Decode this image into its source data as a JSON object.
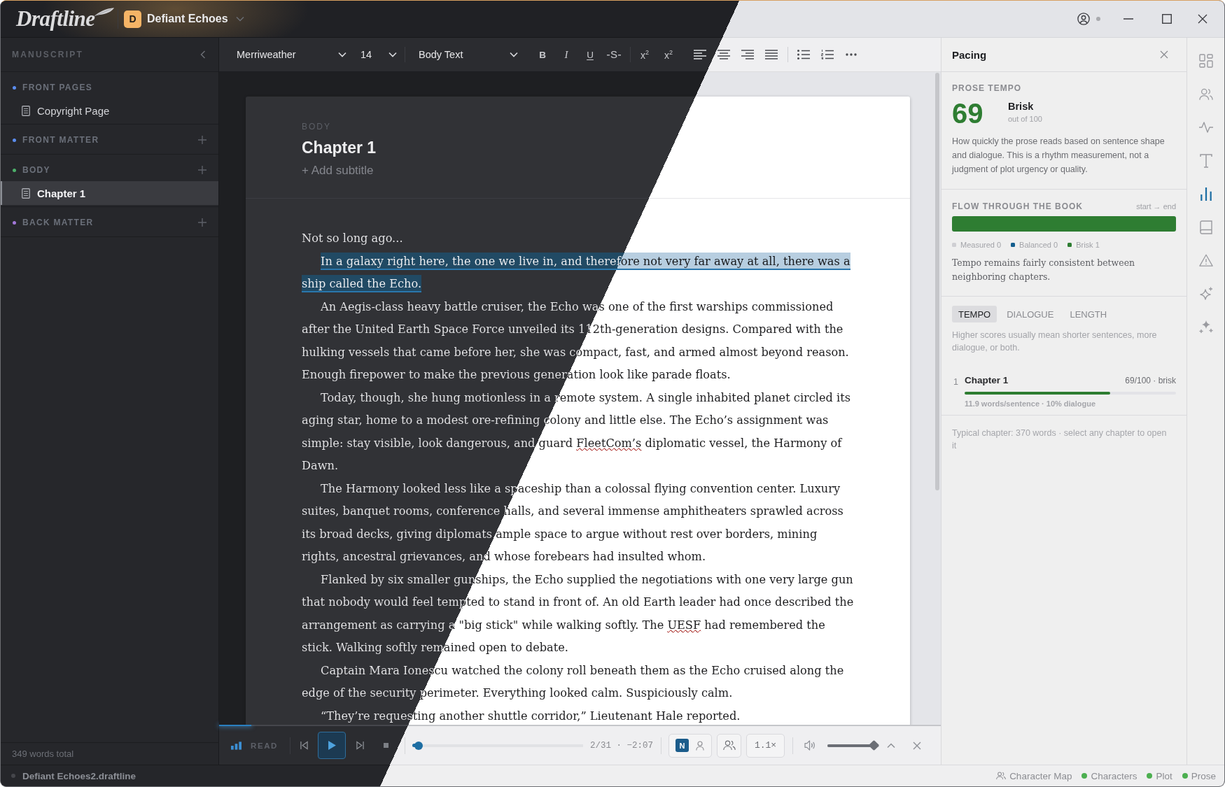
{
  "window": {
    "logo": "Draftline",
    "project": {
      "initial": "D",
      "name": "Defiant Echoes"
    },
    "account": {
      "online": false
    }
  },
  "sidebar": {
    "title": "MANUSCRIPT",
    "sections": [
      {
        "label": "FRONT PAGES",
        "color": "#5b8def",
        "addable": false,
        "items": [
          {
            "label": "Copyright Page",
            "selected": false
          }
        ]
      },
      {
        "label": "FRONT MATTER",
        "color": "#5b8def",
        "addable": true
      },
      {
        "label": "BODY",
        "color": "#4caf6a",
        "addable": true,
        "items": [
          {
            "label": "Chapter 1",
            "selected": true
          }
        ]
      },
      {
        "label": "BACK MATTER",
        "color": "#a277d9",
        "addable": true
      }
    ],
    "footer": "349 words total"
  },
  "toolbar": {
    "font": "Merriweather",
    "size": "14",
    "style": "Body Text",
    "format_buttons": [
      {
        "label": "B",
        "kind": "bold"
      },
      {
        "label": "I",
        "kind": "italic"
      },
      {
        "label": "U",
        "kind": "underline"
      },
      {
        "label": "S",
        "kind": "strike"
      },
      {
        "label": "x$^{2}$",
        "kind": "superscript"
      },
      {
        "label": "x$^{2}$",
        "kind": "superscript"
      }
    ]
  },
  "document": {
    "section": "BODY",
    "title": "Chapter 1",
    "add_subtitle": "+ Add subtitle",
    "paragraphs": [
      {
        "indent": false,
        "highlighted": false,
        "text": "Not so long ago..."
      },
      {
        "indent": true,
        "highlighted": true,
        "text": "In a galaxy right here, the one we live in, and therefore not very far away at all, there was a ship called the Echo."
      },
      {
        "indent": true,
        "highlighted": false,
        "text": "An Aegis-class heavy battle cruiser, the Echo was one of the first warships commissioned after the United Earth Space Force unveiled its 112th-generation designs. Compared with the hulking vessels that came before her, she was compact, fast, and armed almost beyond reason. Enough firepower to make the previous generation look like parade floats."
      },
      {
        "indent": true,
        "highlighted": false,
        "parts": [
          {
            "text": "Today, though, she hung motionless in a remote system. A single inhabited planet circled its aging star, home to a modest ore-refining colony and little else. The Echo’s assignment was simple: stay visible, look dangerous, and guard ",
            "misspelled": false
          },
          {
            "text": "FleetCom’s",
            "misspelled": true
          },
          {
            "text": " diplomatic vessel, the Harmony of Dawn.",
            "misspelled": false
          }
        ]
      },
      {
        "indent": true,
        "highlighted": false,
        "text": "The Harmony looked less like a spaceship than a colossal flying convention center. Luxury suites, banquet rooms, conference halls, and several immense amphitheaters sprawled across its broad decks, giving diplomats ample space to argue without rest over borders, mining rights, ancestral grievances, and whose forebears had insulted whom."
      },
      {
        "indent": true,
        "highlighted": false,
        "parts": [
          {
            "text": "Flanked by six smaller gunships, the Echo supplied the negotiations with one very large gun that nobody would feel tempted to stand in front of. An old Earth leader had once described the arrangement as carrying a \"big stick\" while walking softly. The ",
            "misspelled": false
          },
          {
            "text": "UESF",
            "misspelled": true
          },
          {
            "text": " had remembered the stick. Walking softly remained open to debate.",
            "misspelled": false
          }
        ]
      },
      {
        "indent": true,
        "highlighted": false,
        "text": "Captain Mara Ionescu watched the colony roll beneath them as the Echo cruised along the edge of the security perimeter. Everything looked calm. Suspiciously calm."
      },
      {
        "indent": true,
        "highlighted": false,
        "text": "“They’re requesting another shuttle corridor,” Lieutenant Hale reported."
      }
    ]
  },
  "player": {
    "progress": {
      "level": 0.045
    },
    "mode": "READ",
    "position": {
      "level": 0.035
    },
    "time": "2/31 · −2:07",
    "narrator": {
      "label": "N",
      "selected": true
    },
    "speed": "1.1×",
    "volume": {
      "level": 0.92
    }
  },
  "pacing": {
    "title": "Pacing",
    "tempo": {
      "heading": "PROSE TEMPO",
      "score": "69",
      "label": "Brisk",
      "scale": "out of 100",
      "description": "How quickly the prose reads based on sentence shape and dialogue. This is a rhythm measurement, not a judgment of plot urgency or quality."
    },
    "flow": {
      "heading": "FLOW THROUGH THE BOOK",
      "direction": "start → end",
      "segments": [
        {
          "color": "#2e7d32"
        }
      ],
      "legend": [
        {
          "label": "Measured 0",
          "color": "#cfcfd3"
        },
        {
          "label": "Balanced 0",
          "color": "#145e8e"
        },
        {
          "label": "Brisk 1",
          "color": "#2e7d32"
        }
      ],
      "note": "Tempo remains fairly consistent between neighboring chapters."
    },
    "tabs": [
      {
        "label": "TEMPO",
        "selected": true
      },
      {
        "label": "DIALOGUE",
        "selected": false
      },
      {
        "label": "LENGTH",
        "selected": false
      }
    ],
    "tab_note": "Higher scores usually mean shorter sentences, more dialogue, or both.",
    "chapters": [
      {
        "number": "1",
        "title": "Chapter 1",
        "score": "69/100 · brisk",
        "level": 0.69,
        "stats": "11.9 words/sentence · 10% dialogue"
      }
    ],
    "footer": "Typical chapter: 370 words · select any chapter to open it"
  },
  "rail": [
    {
      "selected": false
    },
    {
      "selected": false
    },
    {
      "selected": false
    },
    {
      "selected": false
    },
    {
      "selected": true
    },
    {
      "selected": false
    },
    {
      "selected": false
    },
    {
      "selected": false
    },
    {
      "selected": false
    }
  ],
  "status_bar": {
    "file": {
      "name": "Defiant Echoes2.draftline",
      "modified": false
    },
    "character_map": "Character Map",
    "indicators": [
      {
        "label": "Characters",
        "on": true
      },
      {
        "label": "Plot",
        "on": true
      },
      {
        "label": "Prose",
        "on": true
      }
    ]
  }
}
